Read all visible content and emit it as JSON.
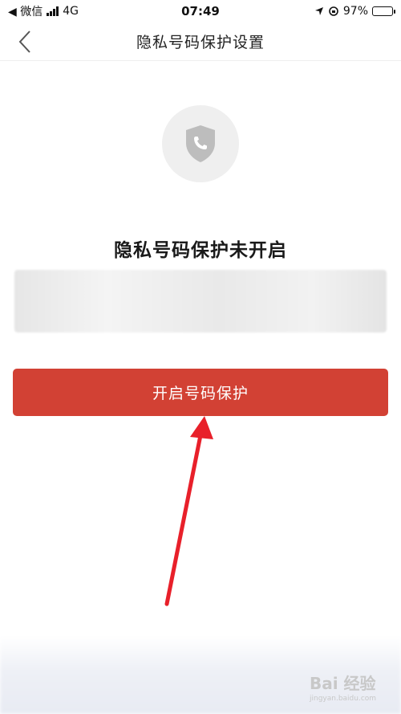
{
  "status_bar": {
    "back_app": "◀ 微信",
    "network": "4G",
    "time": "07:49",
    "battery": "97%",
    "battery_level": 0.97
  },
  "nav": {
    "title": "隐私号码保护设置",
    "back_icon": "chevron-left-icon"
  },
  "content": {
    "shield_icon": "shield-phone-icon",
    "heading": "隐私号码保护未开启",
    "description": ""
  },
  "button": {
    "label": "开启号码保护"
  },
  "annotation": {
    "arrow_color": "#e8202a"
  },
  "watermark": {
    "logo": "Bai 经验",
    "url": "jingyan.baidu.com"
  },
  "colors": {
    "primary": "#d24134",
    "icon_bg": "#efefef",
    "icon_fg": "#bdbdbd"
  }
}
